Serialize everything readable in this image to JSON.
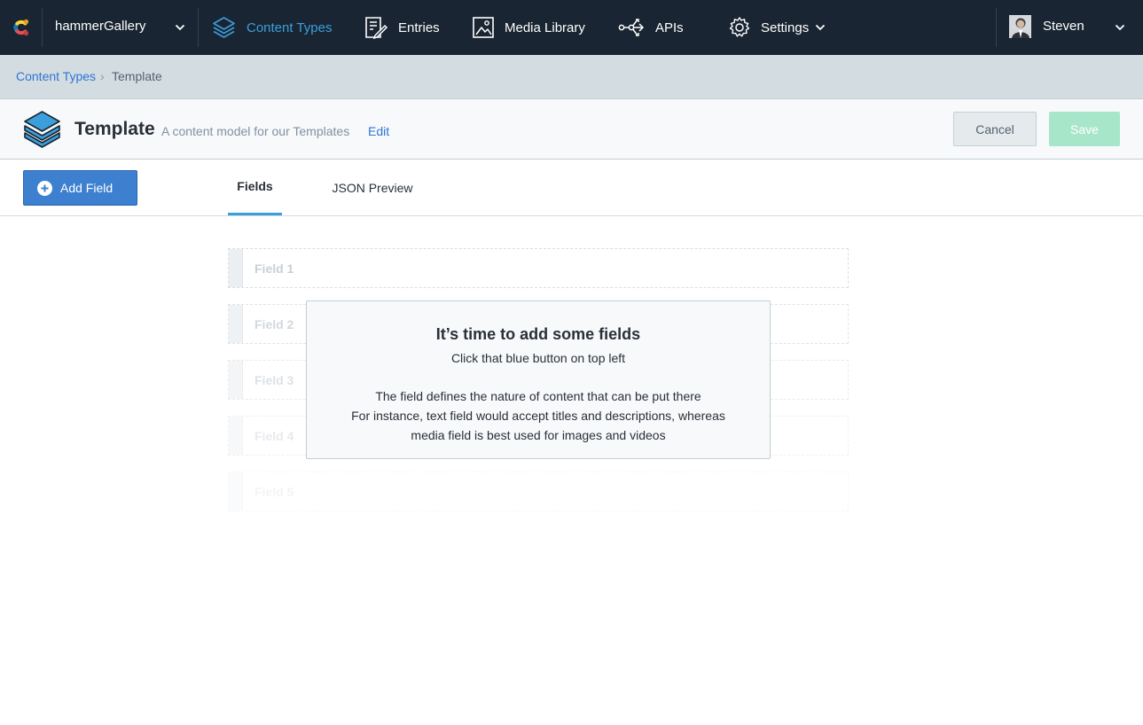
{
  "topnav": {
    "space_name": "hammerGallery",
    "items": [
      {
        "label": "Content Types",
        "icon": "layers-icon",
        "active": true
      },
      {
        "label": "Entries",
        "icon": "entries-icon"
      },
      {
        "label": "Media Library",
        "icon": "media-icon"
      },
      {
        "label": "APIs",
        "icon": "apis-icon"
      },
      {
        "label": "Settings",
        "icon": "gear-icon"
      }
    ],
    "user_name": "Steven"
  },
  "breadcrumb": {
    "link": "Content Types",
    "separator": "›",
    "current": "Template"
  },
  "header": {
    "title": "Template",
    "description": "A content model for our Templates",
    "edit_label": "Edit",
    "cancel_label": "Cancel",
    "save_label": "Save"
  },
  "toolbar": {
    "add_field_label": "Add Field",
    "tabs": [
      {
        "label": "Fields",
        "active": true
      },
      {
        "label": "JSON Preview"
      }
    ]
  },
  "ghost_fields": [
    "Field 1",
    "Field 2",
    "Field 3",
    "Field 4",
    "Field 5"
  ],
  "empty_state": {
    "title": "It’s time to add some fields",
    "subtitle": "Click that blue button on top left",
    "body_line1": "The field defines the nature of content that can be put there",
    "body_line2": "For instance, text field would accept titles and descriptions, whereas",
    "body_line3": "media field is best used for images and videos"
  },
  "colors": {
    "nav_bg": "#192532",
    "accent_blue": "#3c9fdc",
    "button_blue": "#3c80cf",
    "save_green": "#a8e6c9",
    "link_blue": "#2e75d4"
  }
}
